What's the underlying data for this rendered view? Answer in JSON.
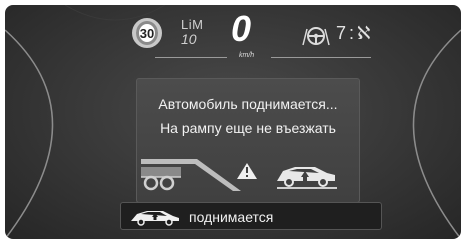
{
  "cluster": {
    "speed_limit_sign": "30",
    "lim_label": "LiM",
    "lim_value": "10",
    "speed": "0",
    "speed_unit": "km/h",
    "gear_display": "7:ℵ"
  },
  "dialog": {
    "line1": "Автомобиль поднимается...",
    "line2": "На рампу еще не въезжать",
    "warning_icon": "warning-triangle-icon",
    "tow_icon": "tow-ramp-icon",
    "car_icon": "car-lift-icon"
  },
  "status": {
    "icon": "car-lift-icon",
    "text": "поднимается"
  }
}
